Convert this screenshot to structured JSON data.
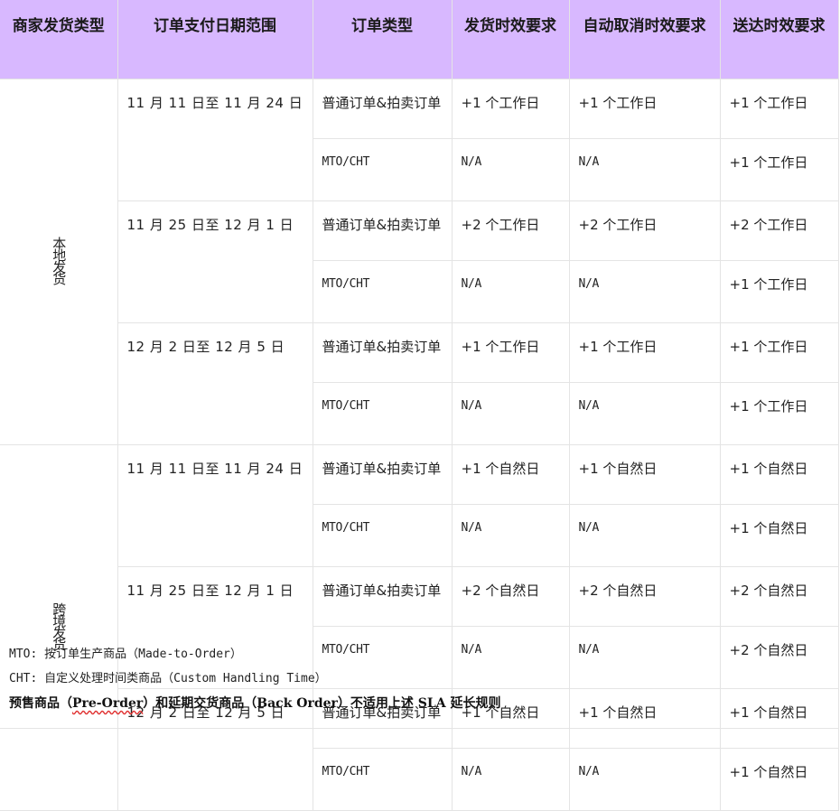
{
  "table": {
    "headers": [
      "商家发货类型",
      "订单支付日期范围",
      "订单类型",
      "发货时效要求",
      "自动取消时效要求",
      "送达时效要求"
    ],
    "groups": [
      {
        "type": "本地发货",
        "periods": [
          {
            "range": "11 月 11 日至 11 月 24 日",
            "rows": [
              {
                "order_type": "普通订单&拍卖订单",
                "ship": "+1 个工作日",
                "cancel": "+1 个工作日",
                "deliver": "+1 个工作日"
              },
              {
                "order_type": "MTO/CHT",
                "ship": "N/A",
                "cancel": "N/A",
                "deliver": "+1 个工作日"
              }
            ]
          },
          {
            "range": "11 月 25 日至 12 月 1 日",
            "rows": [
              {
                "order_type": "普通订单&拍卖订单",
                "ship": "+2 个工作日",
                "cancel": "+2 个工作日",
                "deliver": "+2 个工作日"
              },
              {
                "order_type": "MTO/CHT",
                "ship": "N/A",
                "cancel": "N/A",
                "deliver": "+1 个工作日"
              }
            ]
          },
          {
            "range": "12 月 2 日至 12 月 5 日",
            "rows": [
              {
                "order_type": "普通订单&拍卖订单",
                "ship": "+1 个工作日",
                "cancel": "+1 个工作日",
                "deliver": "+1 个工作日"
              },
              {
                "order_type": "MTO/CHT",
                "ship": "N/A",
                "cancel": "N/A",
                "deliver": "+1 个工作日"
              }
            ]
          }
        ]
      },
      {
        "type": "跨境发货",
        "periods": [
          {
            "range": "11 月 11 日至 11 月 24 日",
            "rows": [
              {
                "order_type": "普通订单&拍卖订单",
                "ship": "+1 个自然日",
                "cancel": "+1 个自然日",
                "deliver": "+1 个自然日"
              },
              {
                "order_type": "MTO/CHT",
                "ship": "N/A",
                "cancel": "N/A",
                "deliver": "+1 个自然日"
              }
            ]
          },
          {
            "range": "11 月 25 日至 12 月 1 日",
            "rows": [
              {
                "order_type": "普通订单&拍卖订单",
                "ship": "+2 个自然日",
                "cancel": "+2 个自然日",
                "deliver": "+2 个自然日"
              },
              {
                "order_type": "MTO/CHT",
                "ship": "N/A",
                "cancel": "N/A",
                "deliver": "+2 个自然日"
              }
            ]
          },
          {
            "range": "12 月 2 日至 12 月 5 日",
            "rows": [
              {
                "order_type": "普通订单&拍卖订单",
                "ship": "+1 个自然日",
                "cancel": "+1 个自然日",
                "deliver": "+1 个自然日"
              },
              {
                "order_type": "MTO/CHT",
                "ship": "N/A",
                "cancel": "N/A",
                "deliver": "+1 个自然日"
              }
            ]
          }
        ]
      }
    ]
  },
  "notes": {
    "mto": "MTO: 按订单生产商品（Made-to-Order）",
    "cht": "CHT: 自定义处理时间类商品（Custom Handling Time）",
    "rule_prefix": "预售商品（",
    "rule_preorder": "Pre-Order",
    "rule_suffix": "）和延期交货商品（Back Order）不适用上述 SLA 延长规则"
  }
}
